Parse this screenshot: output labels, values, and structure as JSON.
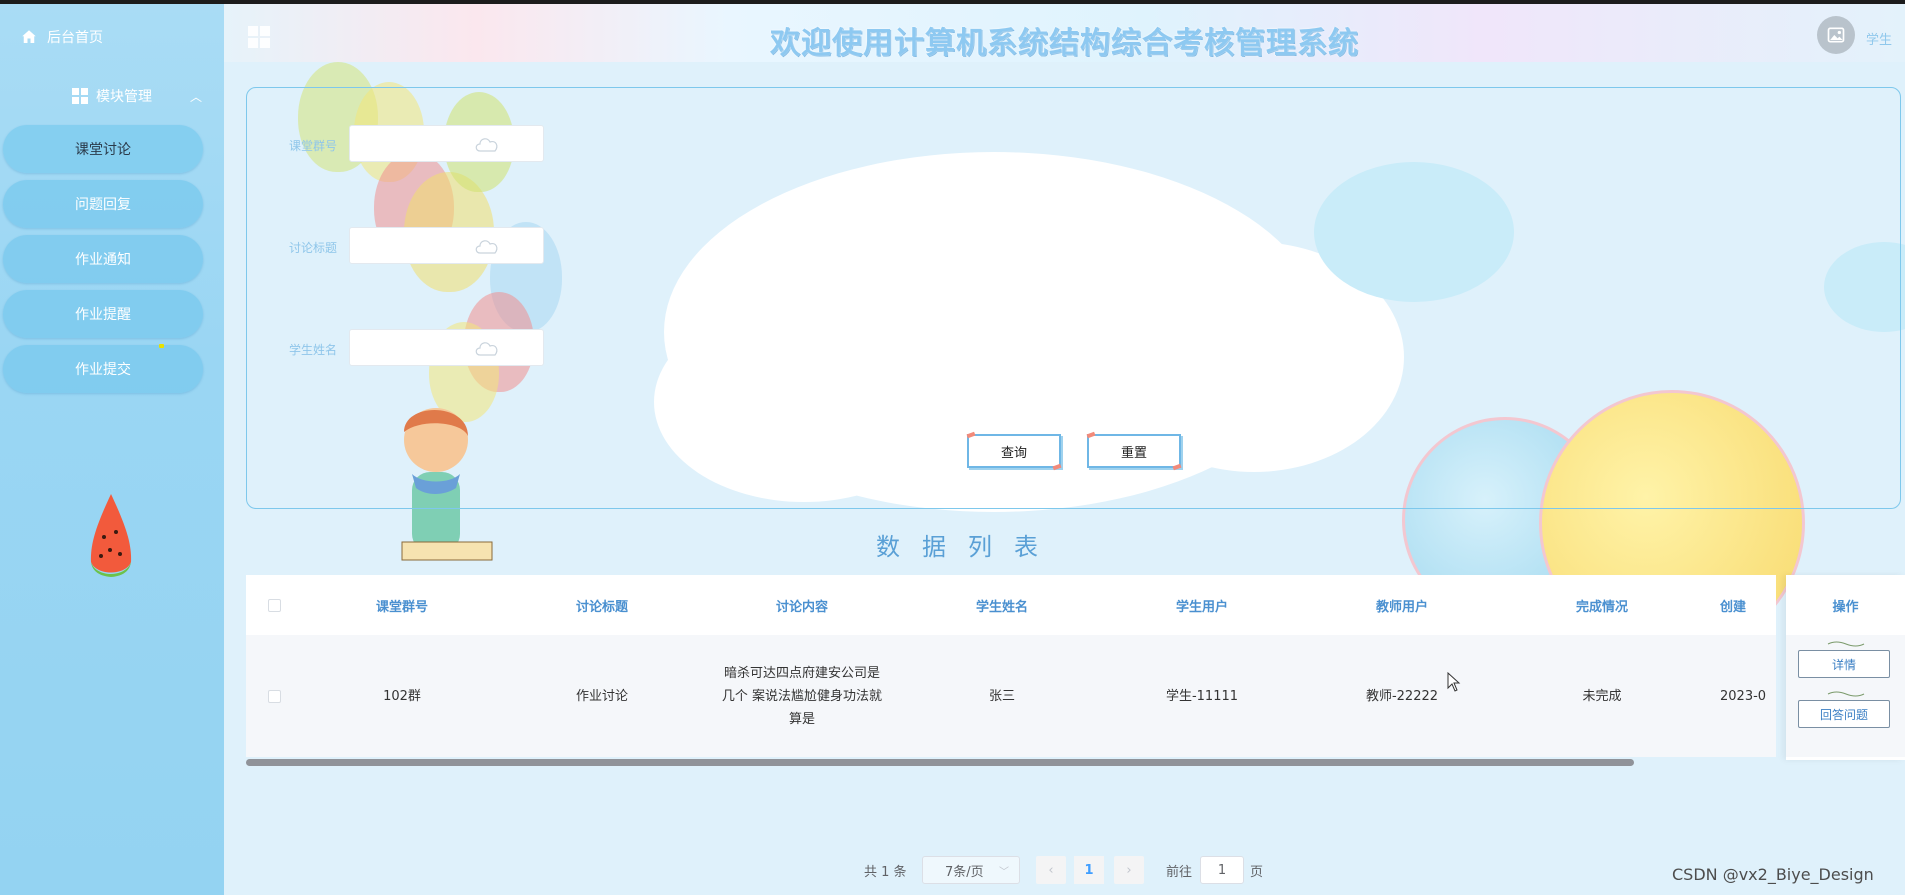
{
  "sidebar": {
    "home_label": "后台首页",
    "group_label": "模块管理",
    "items": [
      {
        "label": "课堂讨论"
      },
      {
        "label": "问题回复"
      },
      {
        "label": "作业通知"
      },
      {
        "label": "作业提醒"
      },
      {
        "label": "作业提交"
      }
    ]
  },
  "header": {
    "title": "欢迎使用计算机系统结构综合考核管理系统",
    "user_role": "学生"
  },
  "search": {
    "fields": [
      {
        "label": "课堂群号",
        "value": ""
      },
      {
        "label": "讨论标题",
        "value": ""
      },
      {
        "label": "学生姓名",
        "value": ""
      }
    ],
    "query_label": "查询",
    "reset_label": "重置"
  },
  "list_title": "数据列表",
  "table": {
    "columns": [
      "课堂群号",
      "讨论标题",
      "讨论内容",
      "学生姓名",
      "学生用户",
      "教师用户",
      "完成情况",
      "创建",
      "操作"
    ],
    "rows": [
      {
        "class_group": "102群",
        "topic": "作业讨论",
        "content_line1": "暗杀可达四点府建安公司是",
        "content_line2": "几个 案说法尴尬健身功法就",
        "content_line3": "算是",
        "student_name": "张三",
        "student_user": "学生-11111",
        "teacher_user": "教师-22222",
        "status": "未完成",
        "created": "2023-0",
        "action_detail": "详情",
        "action_answer": "回答问题"
      }
    ]
  },
  "pagination": {
    "total_text": "共 1 条",
    "page_size": "7条/页",
    "current_page": "1",
    "goto_prefix": "前往",
    "goto_value": "1",
    "goto_suffix": "页"
  },
  "watermark": "CSDN @vx2_Biye_Design",
  "colors": {
    "sidebar_bg": "#9ad6f3",
    "accent_blue": "#4a90d0",
    "title_blue": "#8ec9f1"
  }
}
